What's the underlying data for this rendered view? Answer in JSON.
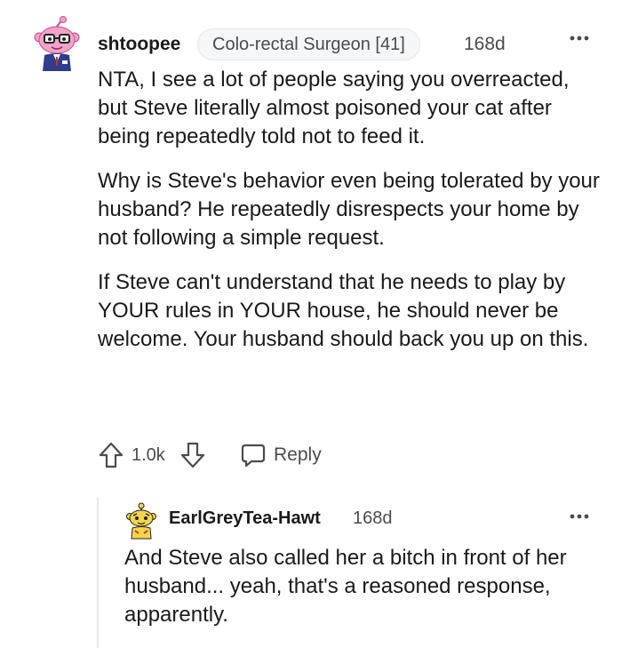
{
  "comment": {
    "username": "shtoopee",
    "flair": "Colo-rectal Surgeon [41]",
    "time": "168d",
    "paragraphs": [
      "NTA, I see a lot of people saying you overreacted, but Steve literally almost poisoned your cat after being repeatedly told not to feed it.",
      "Why is Steve's behavior even being tolerated by your husband? He repeatedly disrespects your home by not following a simple request.",
      "If Steve can't understand that he needs to play by YOUR rules in YOUR house, he should never be welcome. Your husband should back you up on this."
    ],
    "score": "1.0k",
    "reply_label": "Reply"
  },
  "reply": {
    "username": "EarlGreyTea-Hawt",
    "time": "168d",
    "text": "And Steve also called her a bitch in front of her husband... yeah, that's a reasoned response, apparently."
  },
  "icons": {
    "upvote": "upvote-arrow-icon",
    "downvote": "downvote-arrow-icon",
    "reply": "speech-bubble-icon",
    "more": "ellipsis-icon"
  },
  "colors": {
    "text": "#1a1a1b",
    "meta": "#4a4b4d",
    "flair_bg": "#f6f7f8",
    "avatar_pink": "#f4a3c8",
    "avatar_yellow": "#f6d54a"
  }
}
